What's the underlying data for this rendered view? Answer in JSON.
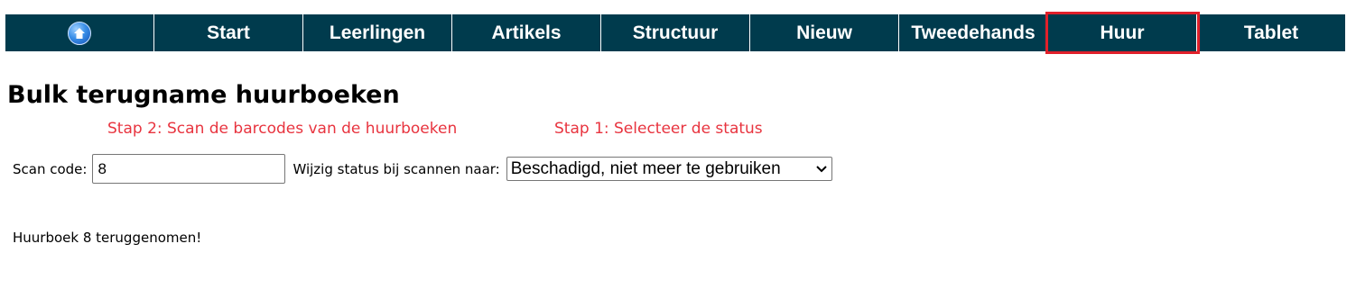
{
  "nav": {
    "items": [
      "Start",
      "Leerlingen",
      "Artikels",
      "Structuur",
      "Nieuw",
      "Tweedehands",
      "Huur",
      "Tablet"
    ]
  },
  "page": {
    "title": "Bulk terugname huurboeken"
  },
  "annotations": {
    "step2": "Stap 2: Scan de barcodes van de huurboeken",
    "step1": "Stap 1: Selecteer de status"
  },
  "form": {
    "scan_label": "Scan code:",
    "scan_value": "8",
    "status_label": "Wijzig status bij scannen naar:",
    "status_selected": "Beschadigd, niet meer te gebruiken"
  },
  "message": "Huurboek 8 teruggenomen!",
  "colors": {
    "nav_bg": "#003b4d",
    "highlight": "#e0202a",
    "annotation": "#e8343f"
  },
  "icons": {
    "home": "home-icon",
    "dropdown": "chevron-down-icon"
  }
}
